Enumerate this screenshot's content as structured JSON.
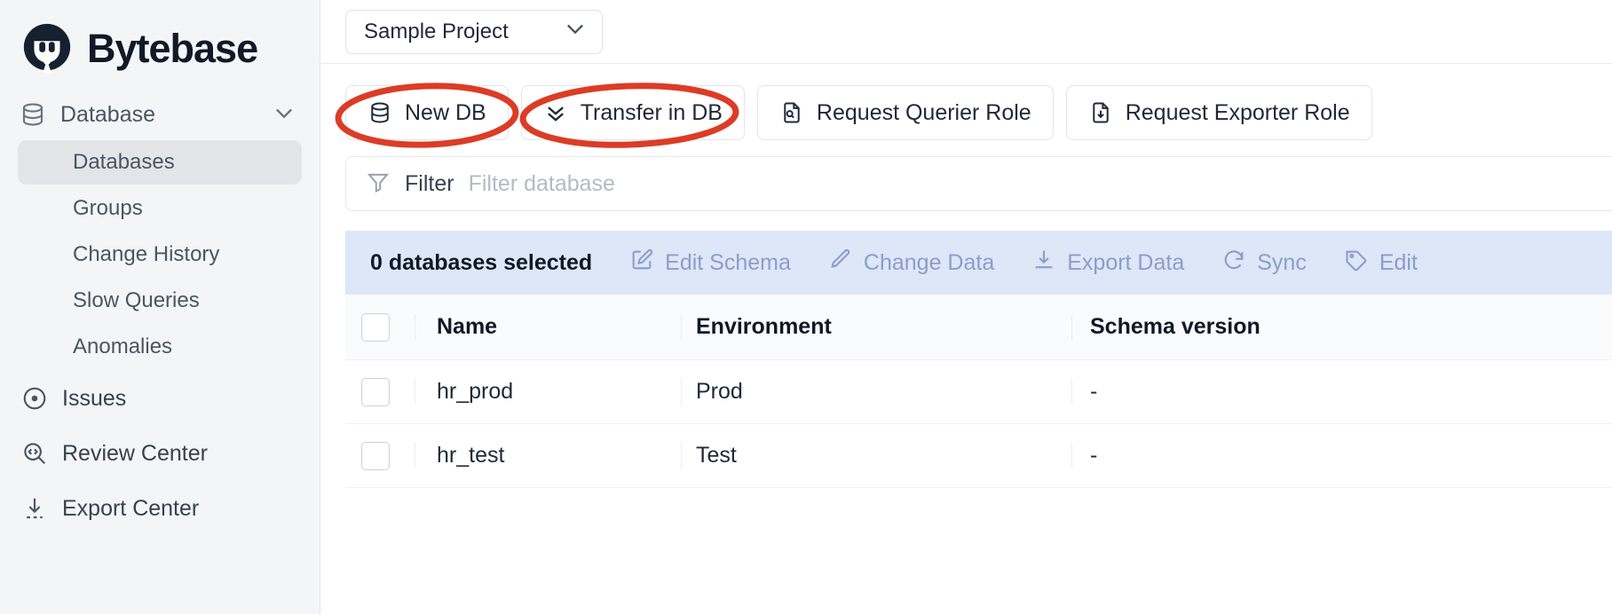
{
  "brand": {
    "name": "Bytebase",
    "logo_icon": "bytebase-logo-icon",
    "accent": "#111827"
  },
  "annotation": {
    "color": "#dc3c26",
    "shapes": [
      "ellipse-new-db",
      "ellipse-transfer-in-db"
    ]
  },
  "sidebar": {
    "group": {
      "label": "Database",
      "icon": "database-icon",
      "chevron": "chevron-down-icon"
    },
    "sub_items": [
      {
        "label": "Databases",
        "active": true
      },
      {
        "label": "Groups",
        "active": false
      },
      {
        "label": "Change History",
        "active": false
      },
      {
        "label": "Slow Queries",
        "active": false
      },
      {
        "label": "Anomalies",
        "active": false
      }
    ],
    "items": [
      {
        "label": "Issues",
        "icon": "issue-circle-dot-icon"
      },
      {
        "label": "Review Center",
        "icon": "code-search-icon"
      },
      {
        "label": "Export Center",
        "icon": "download-arrow-icon"
      }
    ]
  },
  "topbar": {
    "project": "Sample Project",
    "chevron": "chevron-down-icon"
  },
  "toolbar": {
    "buttons": [
      {
        "label": "New DB",
        "icon": "database-icon",
        "annotated": true
      },
      {
        "label": "Transfer in DB",
        "icon": "chevrons-down-icon",
        "annotated": true
      },
      {
        "label": "Request Querier Role",
        "icon": "file-search-icon",
        "annotated": false
      },
      {
        "label": "Request Exporter Role",
        "icon": "file-download-icon",
        "annotated": false
      }
    ]
  },
  "filter": {
    "label": "Filter",
    "icon": "filter-funnel-icon",
    "placeholder": "Filter database",
    "value": ""
  },
  "selection_bar": {
    "count_text": "0 databases selected",
    "background": "#dde7f8",
    "action_color": "#8c9ccb",
    "actions": [
      {
        "label": "Edit Schema",
        "icon": "edit-schema-icon"
      },
      {
        "label": "Change Data",
        "icon": "pencil-icon"
      },
      {
        "label": "Export Data",
        "icon": "download-icon"
      },
      {
        "label": "Sync",
        "icon": "refresh-sync-icon"
      },
      {
        "label": "Edit",
        "icon": "tag-icon"
      }
    ]
  },
  "table": {
    "columns": [
      "Name",
      "Environment",
      "Schema version"
    ],
    "rows": [
      {
        "name": "hr_prod",
        "environment": "Prod",
        "schema_version": "-"
      },
      {
        "name": "hr_test",
        "environment": "Test",
        "schema_version": "-"
      }
    ]
  }
}
